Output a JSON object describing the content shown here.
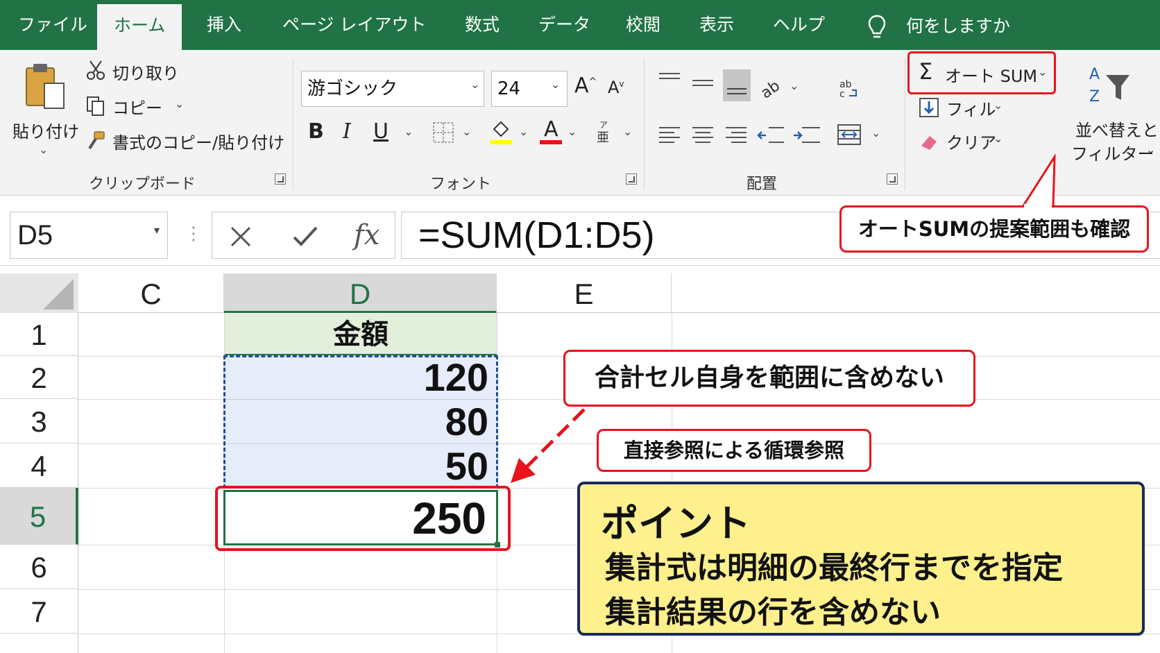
{
  "menu": {
    "tabs": [
      "ファイル",
      "ホーム",
      "挿入",
      "ページ レイアウト",
      "数式",
      "データ",
      "校閲",
      "表示",
      "ヘルプ"
    ],
    "active_tab": "ホーム",
    "tell_me": "何をしますか"
  },
  "ribbon": {
    "clipboard": {
      "paste": "貼り付け",
      "cut": "切り取り",
      "copy": "コピー",
      "format_painter": "書式のコピー/貼り付け",
      "label": "クリップボード"
    },
    "font": {
      "font_name": "游ゴシック",
      "font_size": "24",
      "bold": "B",
      "italic": "I",
      "underline": "U",
      "label": "フォント",
      "fill_color": "#ffff00",
      "font_color": "#e8131b"
    },
    "alignment": {
      "label": "配置"
    },
    "editing": {
      "autosum": "オート SUM",
      "fill": "フィル",
      "clear": "クリア",
      "sort_filter_line1": "並べ替えと",
      "sort_filter_line2": "フィルター"
    }
  },
  "formula_bar": {
    "name_box": "D5",
    "fx": "fx",
    "formula": "=SUM(D1:D5)"
  },
  "sheet": {
    "columns": [
      "C",
      "D",
      "E"
    ],
    "rows": [
      "1",
      "2",
      "3",
      "4",
      "5",
      "6",
      "7"
    ],
    "header_cell": "金額",
    "values": [
      "120",
      "80",
      "50"
    ],
    "total": "250",
    "active_cell": "D5"
  },
  "annotations": {
    "autosum_note": "オートSUMの提案範囲も確認",
    "range_note": "合計セル自身を範囲に含めない",
    "circular_note": "直接参照による循環参照",
    "point_title": "ポイント",
    "point_line1": "集計式は明細の最終行までを指定",
    "point_line2": "集計結果の行を含めない"
  },
  "colors": {
    "excel_green": "#217346",
    "annotation_red": "#e8131b",
    "point_fill": "#fdf08d",
    "point_border": "#1b2a59",
    "range_fill": "#e6ecf9",
    "header_fill": "#e2efda"
  }
}
